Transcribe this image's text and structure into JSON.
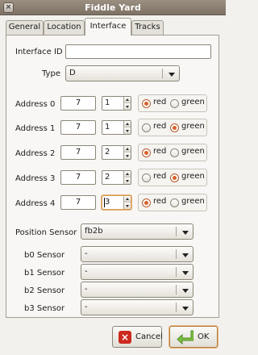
{
  "window": {
    "title": "Fiddle Yard"
  },
  "tabs": [
    {
      "label": "General"
    },
    {
      "label": "Location"
    },
    {
      "label": "Interface",
      "active": true
    },
    {
      "label": "Tracks"
    }
  ],
  "interface": {
    "id_label": "Interface ID",
    "id_value": "",
    "type_label": "Type",
    "type_value": "D"
  },
  "addresses": [
    {
      "label": "Address 0",
      "value": "7",
      "port": "1",
      "color": "red"
    },
    {
      "label": "Address 1",
      "value": "7",
      "port": "1",
      "color": "green"
    },
    {
      "label": "Address 2",
      "value": "7",
      "port": "2",
      "color": "red"
    },
    {
      "label": "Address 3",
      "value": "7",
      "port": "2",
      "color": "green"
    },
    {
      "label": "Address 4",
      "value": "7",
      "port": "3",
      "color": "red",
      "focused": true
    }
  ],
  "radio_labels": {
    "red": "red",
    "green": "green"
  },
  "position_sensor": {
    "label": "Position Sensor",
    "value": "fb2b"
  },
  "sensors": [
    {
      "label": "b0 Sensor",
      "value": "-"
    },
    {
      "label": "b1 Sensor",
      "value": "-"
    },
    {
      "label": "b2 Sensor",
      "value": "-"
    },
    {
      "label": "b3 Sensor",
      "value": "-"
    }
  ],
  "buttons": {
    "cancel": "Cancel",
    "ok": "OK"
  },
  "colors": {
    "titlebar": "#8a7f72",
    "accent": "#d7612b",
    "ok_icon": "#7cc242"
  }
}
